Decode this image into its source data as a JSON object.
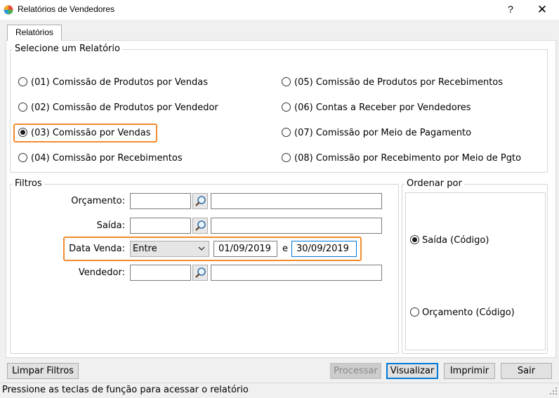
{
  "window": {
    "title": "Relatórios de Vendedores",
    "help_glyph": "?",
    "close_glyph": "✕"
  },
  "tab": {
    "label": "Relatórios"
  },
  "report_group": {
    "label": "Selecione um Relatório",
    "options": [
      {
        "label": "(01) Comissão de Produtos por Vendas",
        "checked": false
      },
      {
        "label": "(02) Comissão de Produtos por Vendedor",
        "checked": false
      },
      {
        "label": "(03) Comissão por Vendas",
        "checked": true
      },
      {
        "label": "(04) Comissão por Recebimentos",
        "checked": false
      },
      {
        "label": "(05) Comissão de Produtos por Recebimentos",
        "checked": false
      },
      {
        "label": "(06) Contas a Receber por Vendedores",
        "checked": false
      },
      {
        "label": "(07) Comissão por Meio de Pagamento",
        "checked": false
      },
      {
        "label": "(08) Comissão por Recebimento por Meio de Pgto",
        "checked": false
      }
    ]
  },
  "filters": {
    "label": "Filtros",
    "orcamento": {
      "label": "Orçamento:",
      "code": "",
      "description": ""
    },
    "saida": {
      "label": "Saída:",
      "code": "",
      "description": ""
    },
    "data_venda": {
      "label": "Data Venda:",
      "mode": "Entre",
      "from": "01/09/2019",
      "between_word": "e",
      "to": "30/09/2019"
    },
    "vendedor": {
      "label": "Vendedor:",
      "code": "",
      "description": ""
    }
  },
  "order": {
    "label": "Ordenar por",
    "options": [
      {
        "label": "Saída (Código)",
        "checked": true
      },
      {
        "label": "Orçamento (Código)",
        "checked": false
      }
    ]
  },
  "buttons": {
    "clear": "Limpar Filtros",
    "process": "Processar",
    "view": "Visualizar",
    "print": "Imprimir",
    "exit": "Sair"
  },
  "status": {
    "text": "Pressione as teclas de função para acessar o relatório"
  },
  "colors": {
    "highlight": "#f28c2e",
    "focus": "#0078d7"
  }
}
